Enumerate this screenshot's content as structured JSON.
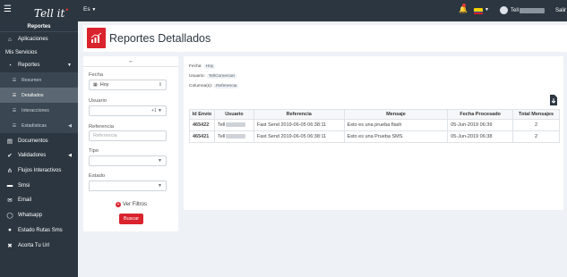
{
  "topbar": {
    "menu_icon": "hamburger-icon",
    "logo": "Tell it",
    "language": "Es",
    "user_prefix": "Tell",
    "logout_label": "Salir"
  },
  "sidebar": {
    "header": "Reportes",
    "items": [
      {
        "label": "Aplicaciones",
        "icon": "home-icon"
      },
      {
        "label": "Mis Servicios",
        "icon": ""
      },
      {
        "label": "Reportes",
        "icon": "chart-pie-icon"
      },
      {
        "label": "Resumen",
        "icon": "list-icon"
      },
      {
        "label": "Detallados",
        "icon": "list-icon"
      },
      {
        "label": "Interacciones",
        "icon": "list-icon"
      },
      {
        "label": "Estadísticas",
        "icon": "list-icon"
      },
      {
        "label": "Documentos",
        "icon": "document-icon"
      },
      {
        "label": "Validadores",
        "icon": "check-icon"
      },
      {
        "label": "Flujos Interactivos",
        "icon": "flow-icon"
      },
      {
        "label": "Smsi",
        "icon": "chat-icon"
      },
      {
        "label": "Email",
        "icon": "envelope-icon"
      },
      {
        "label": "Whatsapp",
        "icon": "whatsapp-icon"
      },
      {
        "label": "Estado Rutas Sms",
        "icon": "route-icon"
      },
      {
        "label": "Acorta Tu Url",
        "icon": "link-icon"
      }
    ]
  },
  "page": {
    "title": "Reportes Detallados"
  },
  "filters": {
    "fecha_label": "Fecha",
    "fecha_value": "Hoy",
    "usuario_label": "Usuario",
    "usuario_value": "+1",
    "referencia_label": "Referencia",
    "referencia_placeholder": "Referencia",
    "tipo_label": "Tipo",
    "estado_label": "Estado",
    "ver_filtros": "Ver Filtros",
    "buscar": "Buscar"
  },
  "applied": {
    "fecha_label": "Fecha:",
    "fecha_value": "Hoy",
    "usuario_label": "Usuario:",
    "usuario_value": "TellComercial",
    "columnas_label": "Columna(s):",
    "columnas_value": "Referencia"
  },
  "table": {
    "headers": [
      "Id Envío",
      "Usuario",
      "Referencia",
      "Mensaje",
      "Fecha Procesado",
      "Total Mensajes"
    ],
    "rows": [
      {
        "id": "465422",
        "usuario": "Tell",
        "referencia": "Fast Send 2019-06-05 06:38:11",
        "mensaje": "Esto es una prueba flash",
        "fecha": "05-Jun-2019 06:39",
        "total": "2"
      },
      {
        "id": "465421",
        "usuario": "Tell",
        "referencia": "Fast Send 2019-06-05 06:38:11",
        "mensaje": "Esto es una Prueba SMS",
        "fecha": "05-Jun-2019 06:38",
        "total": "2"
      }
    ]
  },
  "colors": {
    "navbar": "#2b3640",
    "accent": "#d9232d",
    "background": "#eef1f5"
  }
}
